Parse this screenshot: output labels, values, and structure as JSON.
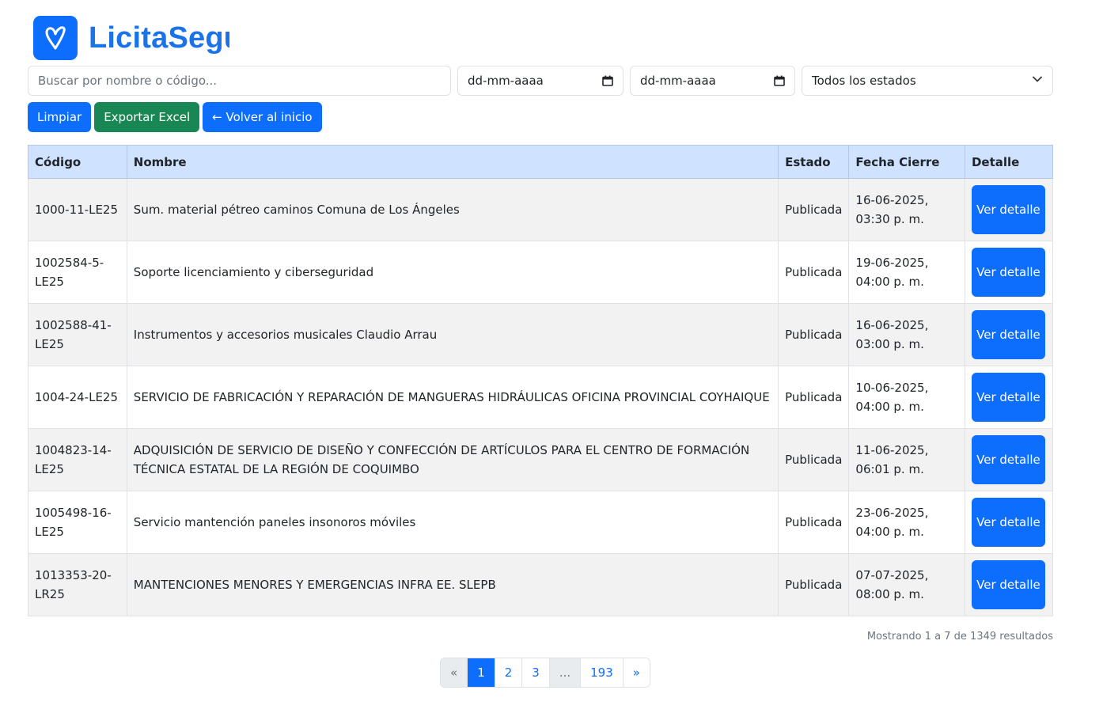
{
  "brand": {
    "name": "LicitaSeguro"
  },
  "filters": {
    "search_placeholder": "Buscar por nombre o código...",
    "date_from": "dd-mm-aaaa",
    "date_to": "dd-mm-aaaa",
    "status_selected": "Todos los estados"
  },
  "actions": {
    "clear": "Limpiar",
    "export": "Exportar Excel",
    "back": "← Volver al inicio"
  },
  "table": {
    "headers": [
      "Código",
      "Nombre",
      "Estado",
      "Fecha Cierre",
      "Detalle"
    ],
    "rows": [
      {
        "codigo": "1000-11-LE25",
        "nombre": "Sum. material pétreo caminos Comuna de Los Ángeles",
        "estado": "Publicada",
        "fecha": "16-06-2025, 03:30 p. m.",
        "detalle": "Ver detalle"
      },
      {
        "codigo": "1002584-5-LE25",
        "nombre": "Soporte licenciamiento y ciberseguridad",
        "estado": "Publicada",
        "fecha": "19-06-2025, 04:00 p. m.",
        "detalle": "Ver detalle"
      },
      {
        "codigo": "1002588-41-LE25",
        "nombre": "Instrumentos y accesorios musicales Claudio Arrau",
        "estado": "Publicada",
        "fecha": "16-06-2025, 03:00 p. m.",
        "detalle": "Ver detalle"
      },
      {
        "codigo": "1004-24-LE25",
        "nombre": "SERVICIO DE FABRICACIÓN Y REPARACIÓN DE MANGUERAS HIDRÁULICAS OFICINA PROVINCIAL COYHAIQUE",
        "estado": "Publicada",
        "fecha": "10-06-2025, 04:00 p. m.",
        "detalle": "Ver detalle"
      },
      {
        "codigo": "1004823-14-LE25",
        "nombre": "ADQUISICIÓN DE SERVICIO DE DISEÑO Y CONFECCIÓN DE ARTÍCULOS PARA EL CENTRO DE FORMACIÓN TÉCNICA ESTATAL DE LA REGIÓN DE COQUIMBO",
        "estado": "Publicada",
        "fecha": "11-06-2025, 06:01 p. m.",
        "detalle": "Ver detalle"
      },
      {
        "codigo": "1005498-16-LE25",
        "nombre": "Servicio mantención paneles insonoros móviles",
        "estado": "Publicada",
        "fecha": "23-06-2025, 04:00 p. m.",
        "detalle": "Ver detalle"
      },
      {
        "codigo": "1013353-20-LR25",
        "nombre": "MANTENCIONES MENORES Y EMERGENCIAS INFRA EE. SLEPB",
        "estado": "Publicada",
        "fecha": "07-07-2025, 08:00 p. m.",
        "detalle": "Ver detalle"
      }
    ]
  },
  "summary": "Mostrando 1 a 7 de 1349 resultados",
  "pagination": {
    "prev": "«",
    "pages": [
      "1",
      "2",
      "3",
      "...",
      "193"
    ],
    "active": "1",
    "next": "»"
  },
  "colors": {
    "primary": "#0d6efd",
    "success": "#198754",
    "header_bg": "#cfe2ff",
    "brand_text": "#1a73e8"
  }
}
